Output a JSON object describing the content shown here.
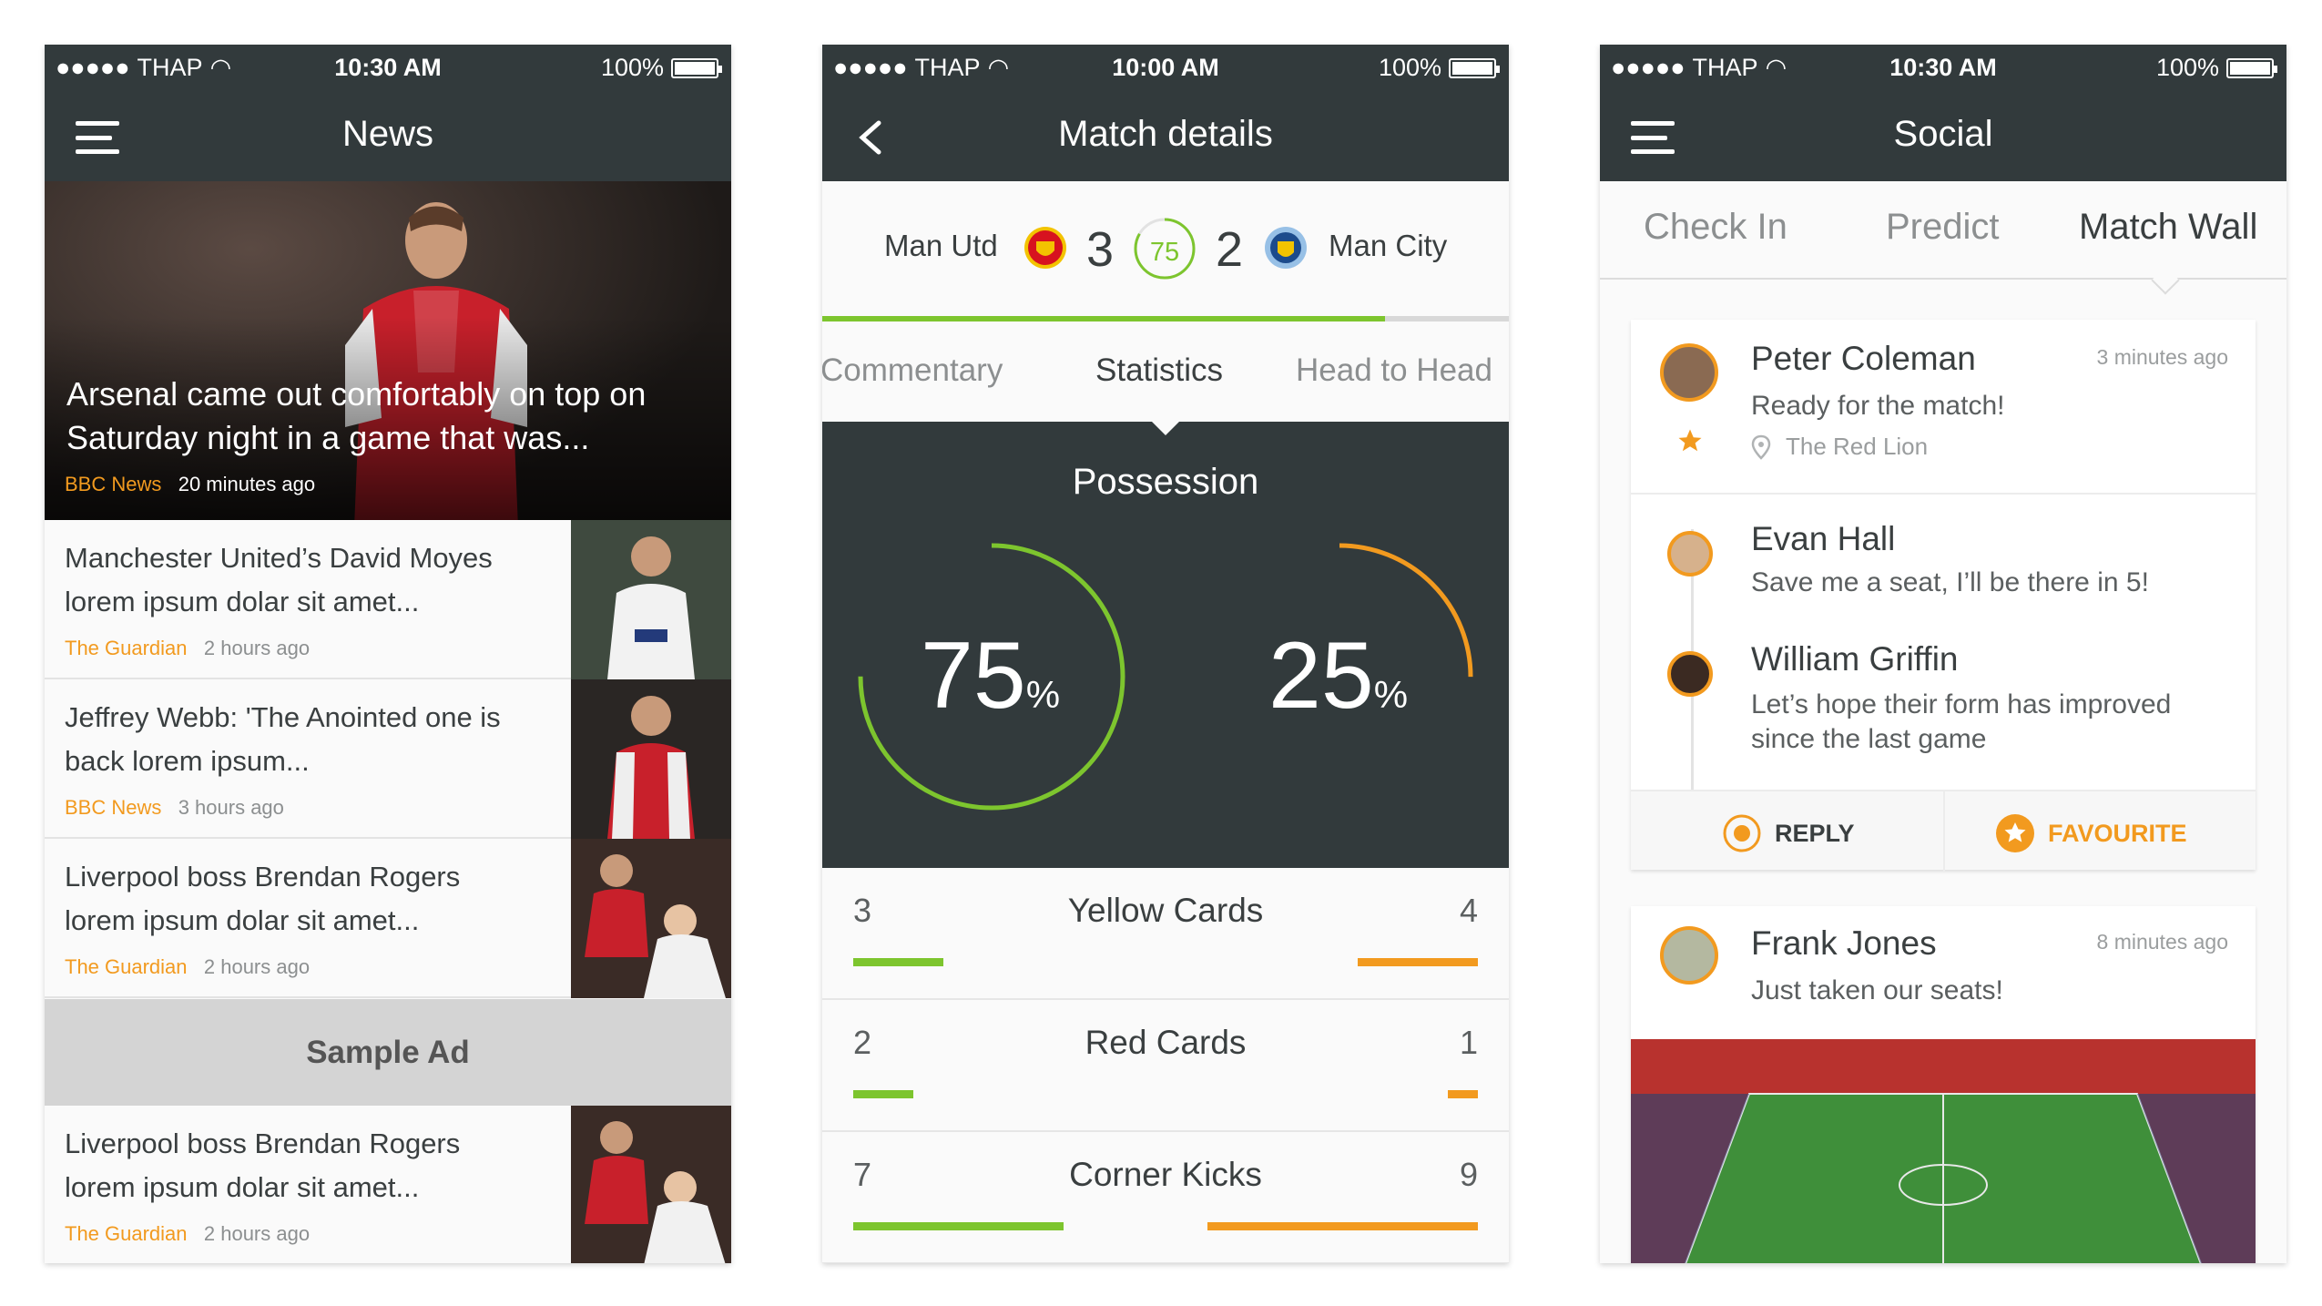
{
  "status_bars": [
    {
      "carrier": "THAP",
      "time": "10:30 AM",
      "battery": "100%"
    },
    {
      "carrier": "THAP",
      "time": "10:00 AM",
      "battery": "100%"
    },
    {
      "carrier": "THAP",
      "time": "10:30 AM",
      "battery": "100%"
    }
  ],
  "news": {
    "title": "News",
    "hero": {
      "headline": "Arsenal came out comfortably on top on Saturday night in a game that was...",
      "source": "BBC News",
      "time": "20 minutes ago"
    },
    "items": [
      {
        "headline": "Manchester United’s David Moyes lorem ipsum dolar sit amet...",
        "source": "The Guardian",
        "time": "2 hours ago"
      },
      {
        "headline": "Jeffrey Webb: 'The Anointed one is back lorem ipsum...",
        "source": "BBC News",
        "time": "3 hours ago"
      },
      {
        "headline": "Liverpool boss Brendan Rogers lorem ipsum dolar sit amet...",
        "source": "The Guardian",
        "time": "2 hours ago"
      },
      {
        "headline": "Liverpool boss Brendan Rogers lorem ipsum dolar sit amet...",
        "source": "The Guardian",
        "time": "2 hours ago"
      }
    ],
    "ad_label": "Sample Ad"
  },
  "match": {
    "title": "Match details",
    "home_team": "Man Utd",
    "home_score": "3",
    "minute": "75",
    "away_score": "2",
    "away_team": "Man City",
    "match_progress": 0.82,
    "tabs": [
      "Commentary",
      "Statistics",
      "Head to Head"
    ],
    "active_tab": "Statistics",
    "possession": {
      "title": "Possession",
      "home": "75",
      "away": "25",
      "unit": "%"
    },
    "stats": [
      {
        "label": "Yellow Cards",
        "home": "3",
        "away": "4"
      },
      {
        "label": "Red Cards",
        "home": "2",
        "away": "1"
      },
      {
        "label": "Corner Kicks",
        "home": "7",
        "away": "9"
      }
    ],
    "colors": {
      "home": "#7dc52e",
      "away": "#f29a1f"
    }
  },
  "social": {
    "title": "Social",
    "tabs": [
      "Check In",
      "Predict",
      "Match Wall"
    ],
    "active_tab": "Match Wall",
    "posts": [
      {
        "name": "Peter Coleman",
        "message": "Ready for the match!",
        "ago": "3 minutes ago",
        "location": "The Red Lion"
      },
      {
        "name": "Evan Hall",
        "message": "Save me a seat, I’ll be there in 5!"
      },
      {
        "name": "William Griffin",
        "message_line1": "Let’s hope their form has improved",
        "message_line2": "since the last game"
      }
    ],
    "actions": {
      "reply": "REPLY",
      "favourite": "FAVOURITE"
    },
    "post2": {
      "name": "Frank Jones",
      "message": "Just taken our seats!",
      "ago": "8 minutes ago"
    }
  }
}
